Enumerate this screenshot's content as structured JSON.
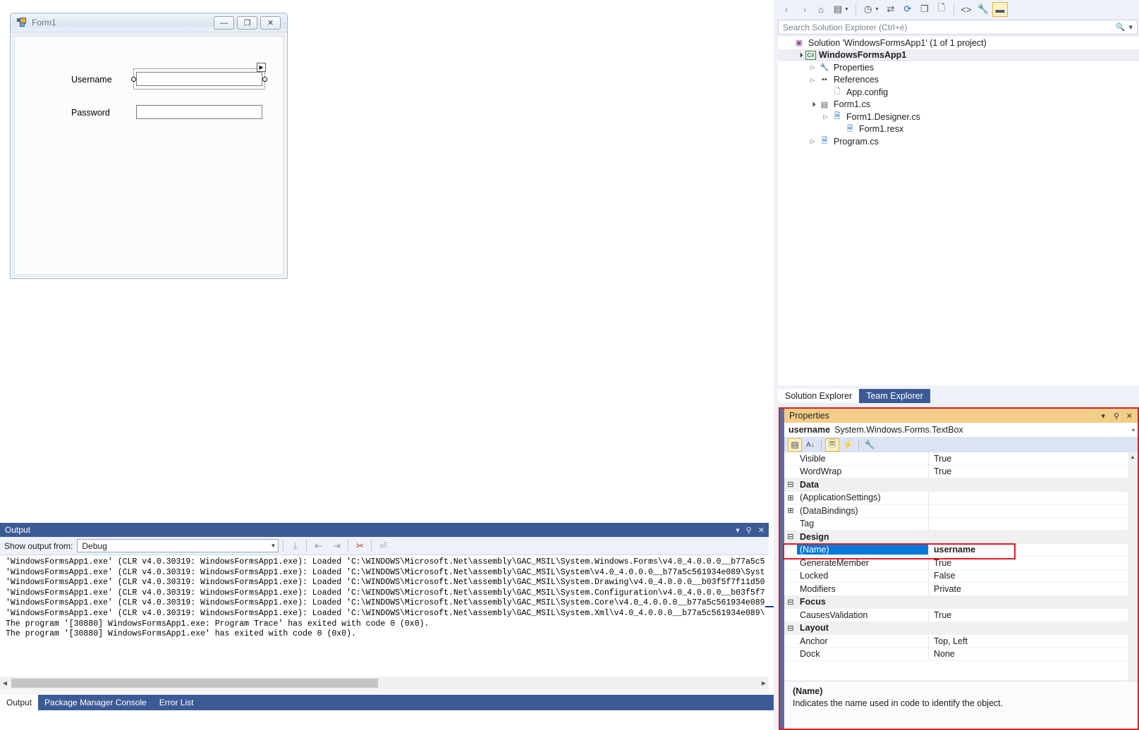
{
  "designer": {
    "form_title": "Form1",
    "window_buttons": [
      {
        "name": "minimize",
        "glyph": "—"
      },
      {
        "name": "maximize",
        "glyph": "❐"
      },
      {
        "name": "close",
        "glyph": "✕"
      }
    ],
    "labels": {
      "username": "Username",
      "password": "Password"
    },
    "selected_control": "username"
  },
  "output": {
    "title": "Output",
    "show_output_from_label": "Show output from:",
    "selected_source": "Debug",
    "lines": [
      "'WindowsFormsApp1.exe' (CLR v4.0.30319: WindowsFormsApp1.exe): Loaded 'C:\\WINDOWS\\Microsoft.Net\\assembly\\GAC_MSIL\\System.Windows.Forms\\v4.0_4.0.0.0__b77a5c5",
      "'WindowsFormsApp1.exe' (CLR v4.0.30319: WindowsFormsApp1.exe): Loaded 'C:\\WINDOWS\\Microsoft.Net\\assembly\\GAC_MSIL\\System\\v4.0_4.0.0.0__b77a5c561934e089\\Syst",
      "'WindowsFormsApp1.exe' (CLR v4.0.30319: WindowsFormsApp1.exe): Loaded 'C:\\WINDOWS\\Microsoft.Net\\assembly\\GAC_MSIL\\System.Drawing\\v4.0_4.0.0.0__b03f5f7f11d50",
      "'WindowsFormsApp1.exe' (CLR v4.0.30319: WindowsFormsApp1.exe): Loaded 'C:\\WINDOWS\\Microsoft.Net\\assembly\\GAC_MSIL\\System.Configuration\\v4.0_4.0.0.0__b03f5f7",
      "'WindowsFormsApp1.exe' (CLR v4.0.30319: WindowsFormsApp1.exe): Loaded 'C:\\WINDOWS\\Microsoft.Net\\assembly\\GAC_MSIL\\System.Core\\v4.0_4.0.0.0__b77a5c561934e089",
      "'WindowsFormsApp1.exe' (CLR v4.0.30319: WindowsFormsApp1.exe): Loaded 'C:\\WINDOWS\\Microsoft.Net\\assembly\\GAC_MSIL\\System.Xml\\v4.0_4.0.0.0__b77a5c561934e089\\",
      "The program '[30880] WindowsFormsApp1.exe: Program Trace' has exited with code 0 (0x0).",
      "The program '[30880] WindowsFormsApp1.exe' has exited with code 0 (0x0)."
    ],
    "toolbar_icons": [
      "find-message",
      "go-to-previous",
      "go-to-next",
      "clear-all",
      "toggle-word-wrap"
    ]
  },
  "bottom_tabs": [
    {
      "label": "Output",
      "active": true
    },
    {
      "label": "Package Manager Console",
      "active": false
    },
    {
      "label": "Error List",
      "active": false
    }
  ],
  "solution_explorer": {
    "toolbar": [
      {
        "name": "back",
        "glyph": "◀"
      },
      {
        "name": "forward",
        "glyph": "▶"
      },
      {
        "name": "home",
        "glyph": "⌂"
      },
      {
        "name": "new-folder",
        "glyph": "🗂"
      },
      {
        "name": "pending-changes",
        "glyph": "◷"
      },
      {
        "name": "sync-with-active-document",
        "glyph": "⇄"
      },
      {
        "name": "refresh",
        "glyph": "⟳"
      },
      {
        "name": "collapse-all",
        "glyph": "❒"
      },
      {
        "name": "show-all-files",
        "glyph": "🗋"
      },
      {
        "name": "view-code",
        "glyph": "<>"
      },
      {
        "name": "properties",
        "glyph": "🔧"
      },
      {
        "name": "preview-selected-items",
        "glyph": "▬"
      }
    ],
    "search_placeholder": "Search Solution Explorer (Ctrl+é)",
    "tree": [
      {
        "label": "Solution 'WindowsFormsApp1' (1 of 1 project)",
        "indent": 0,
        "twisty": "",
        "icon": "solution-icon",
        "bold": false,
        "selected": false
      },
      {
        "label": "WindowsFormsApp1",
        "indent": 1,
        "twisty": "expanded",
        "icon": "csharp-project-icon",
        "bold": true,
        "selected": true
      },
      {
        "label": "Properties",
        "indent": 2,
        "twisty": "collapsed",
        "icon": "wrench-icon",
        "bold": false,
        "selected": false
      },
      {
        "label": "References",
        "indent": 2,
        "twisty": "collapsed",
        "icon": "references-icon",
        "bold": false,
        "selected": false
      },
      {
        "label": "App.config",
        "indent": 3,
        "twisty": "",
        "icon": "config-file-icon",
        "bold": false,
        "selected": false
      },
      {
        "label": "Form1.cs",
        "indent": 2,
        "twisty": "expanded",
        "icon": "form-file-icon",
        "bold": false,
        "selected": false
      },
      {
        "label": "Form1.Designer.cs",
        "indent": 3,
        "twisty": "collapsed",
        "icon": "csharp-file-icon",
        "bold": false,
        "selected": false
      },
      {
        "label": "Form1.resx",
        "indent": 4,
        "twisty": "",
        "icon": "resx-file-icon",
        "bold": false,
        "selected": false
      },
      {
        "label": "Program.cs",
        "indent": 2,
        "twisty": "collapsed",
        "icon": "csharp-file-icon",
        "bold": false,
        "selected": false
      }
    ],
    "tabs": [
      {
        "label": "Solution Explorer",
        "active": true
      },
      {
        "label": "Team Explorer",
        "active": false
      }
    ]
  },
  "properties": {
    "title": "Properties",
    "object_name": "username",
    "object_type": "System.Windows.Forms.TextBox",
    "toolbar": [
      {
        "name": "categorized",
        "glyph": "▤",
        "selected": true
      },
      {
        "name": "alphabetical",
        "glyph": "A↓",
        "selected": false
      },
      {
        "name": "properties-page",
        "glyph": "🗏",
        "selected": true
      },
      {
        "name": "events",
        "glyph": "⚡",
        "selected": false
      },
      {
        "name": "property-pages",
        "glyph": "🔧",
        "selected": false
      }
    ],
    "rows": [
      {
        "kind": "prop",
        "name": "Visible",
        "value": "True",
        "selected": false
      },
      {
        "kind": "prop",
        "name": "WordWrap",
        "value": "True",
        "selected": false
      },
      {
        "kind": "category",
        "name": "Data",
        "value": "",
        "expander": "−",
        "selected": false
      },
      {
        "kind": "prop",
        "name": "(ApplicationSettings)",
        "value": "",
        "expander": "+",
        "selected": false
      },
      {
        "kind": "prop",
        "name": "(DataBindings)",
        "value": "",
        "expander": "+",
        "selected": false
      },
      {
        "kind": "prop",
        "name": "Tag",
        "value": "",
        "selected": false
      },
      {
        "kind": "category",
        "name": "Design",
        "value": "",
        "expander": "−",
        "selected": false
      },
      {
        "kind": "prop",
        "name": "(Name)",
        "value": "username",
        "selected": true
      },
      {
        "kind": "prop",
        "name": "GenerateMember",
        "value": "True",
        "selected": false
      },
      {
        "kind": "prop",
        "name": "Locked",
        "value": "False",
        "selected": false
      },
      {
        "kind": "prop",
        "name": "Modifiers",
        "value": "Private",
        "selected": false
      },
      {
        "kind": "category",
        "name": "Focus",
        "value": "",
        "expander": "−",
        "selected": false
      },
      {
        "kind": "prop",
        "name": "CausesValidation",
        "value": "True",
        "selected": false
      },
      {
        "kind": "category",
        "name": "Layout",
        "value": "",
        "expander": "−",
        "selected": false
      },
      {
        "kind": "prop",
        "name": "Anchor",
        "value": "Top, Left",
        "selected": false
      },
      {
        "kind": "prop",
        "name": "Dock",
        "value": "None",
        "selected": false
      }
    ],
    "description_title": "(Name)",
    "description_text": "Indicates the name used in code to identify the object."
  },
  "colors": {
    "accent_blue": "#3c5a96",
    "highlight_red": "#e01b22",
    "properties_title_bg": "#f4cd87",
    "selection_blue": "#0078d7"
  }
}
